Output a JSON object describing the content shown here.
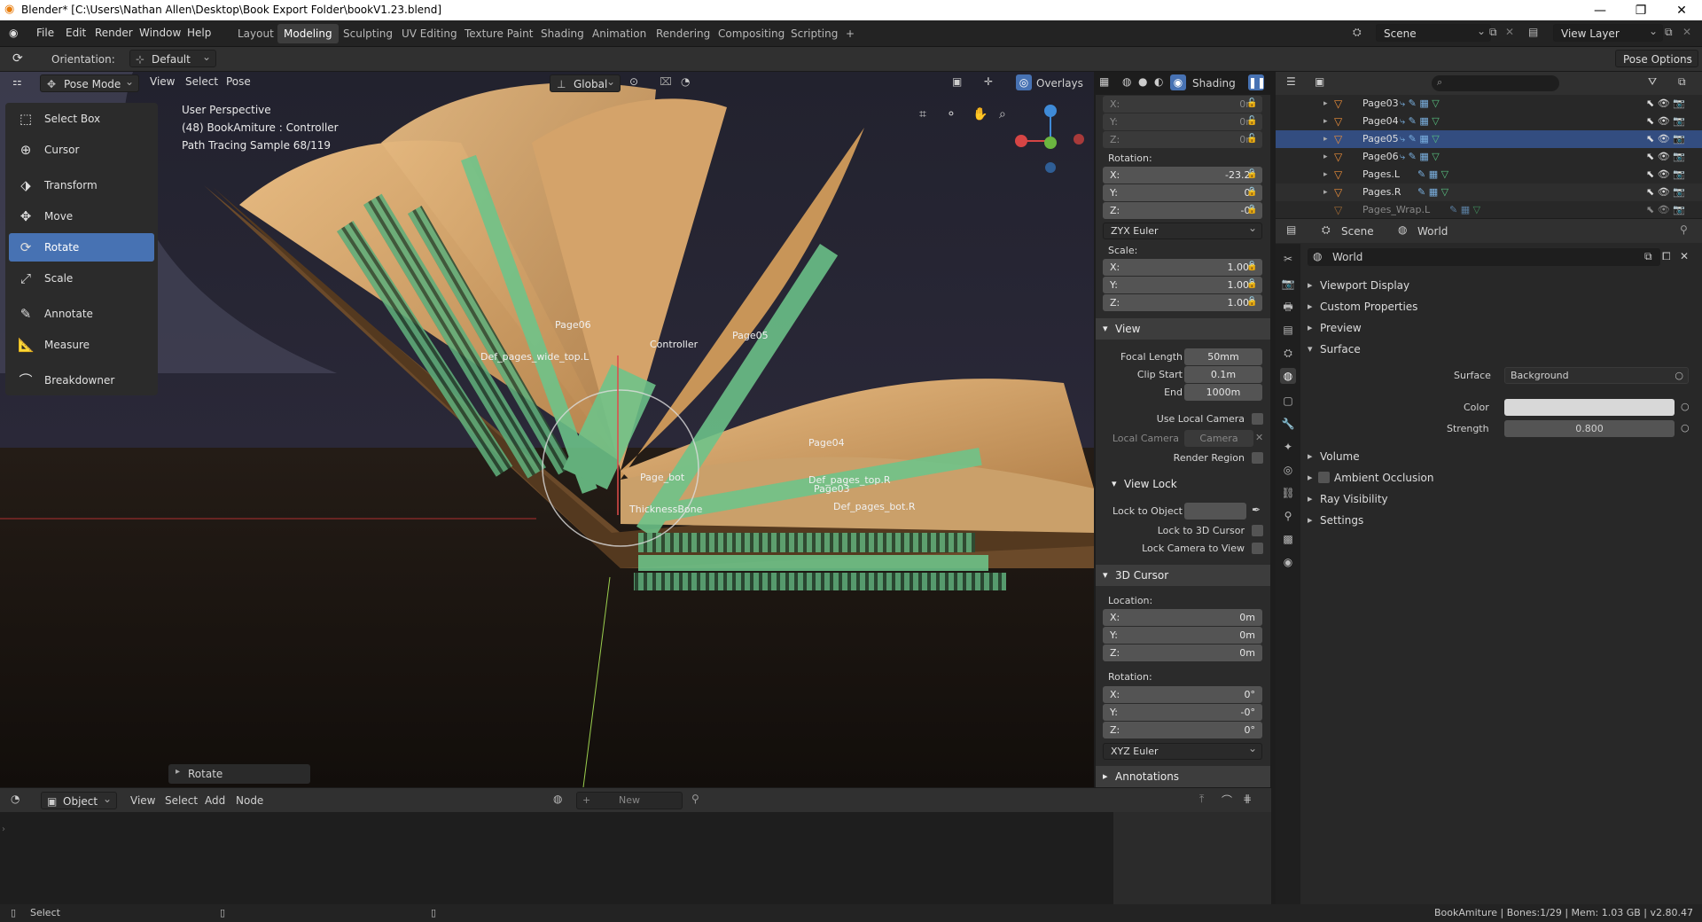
{
  "window": {
    "title": "Blender* [C:\\Users\\Nathan Allen\\Desktop\\Book Export Folder\\bookV1.23.blend]"
  },
  "menu": {
    "items": [
      "File",
      "Edit",
      "Render",
      "Window",
      "Help"
    ]
  },
  "workspaces": {
    "tabs": [
      "Layout",
      "Modeling",
      "Sculpting",
      "UV Editing",
      "Texture Paint",
      "Shading",
      "Animation",
      "Rendering",
      "Compositing",
      "Scripting"
    ],
    "active": "Modeling",
    "add": "+"
  },
  "scene": {
    "name": "Scene",
    "view_layer": "View Layer"
  },
  "tool_header": {
    "orientation_label": "Orientation:",
    "orientation_value": "Default",
    "pose_options": "Pose Options"
  },
  "viewport_header": {
    "mode": "Pose Mode",
    "menus": [
      "View",
      "Select",
      "Pose"
    ],
    "transform_orientation": "Global",
    "overlays": "Overlays",
    "shading": "Shading"
  },
  "toolbar": {
    "tools": [
      "Select Box",
      "Cursor",
      "Transform",
      "Move",
      "Rotate",
      "Scale",
      "Annotate",
      "Measure",
      "Breakdowner"
    ],
    "active": "Rotate"
  },
  "viewport_info": {
    "perspective": "User Perspective",
    "object": "(48) BookAmiture : Controller",
    "render": "Path Tracing Sample 68/119"
  },
  "bone_labels": [
    "Page06",
    "Def_pages_wide_top.L",
    "Controller",
    "Page05",
    "Page04",
    "Page_bot",
    "Def_pages_top.R",
    "Page03",
    "ThicknessBone",
    "Def_pages_bot.R"
  ],
  "last_op": "Rotate",
  "npanel": {
    "location_values": [
      "0m",
      "0m",
      "0m"
    ],
    "rotation_label": "Rotation:",
    "rotation_values": [
      "-23.2°",
      "0°",
      "-0°"
    ],
    "rotation_mode": "ZYX Euler",
    "scale_label": "Scale:",
    "scale_values": [
      "1.000",
      "1.000",
      "1.000"
    ],
    "axis": [
      "X:",
      "Y:",
      "Z:"
    ],
    "view": {
      "title": "View",
      "focal_label": "Focal Length",
      "focal": "50mm",
      "clip_start_label": "Clip Start",
      "clip_start": "0.1m",
      "end_label": "End",
      "end": "1000m",
      "use_local_camera": "Use Local Camera",
      "local_camera_label": "Local Camera",
      "local_camera": "Camera",
      "render_region": "Render Region"
    },
    "view_lock": {
      "title": "View Lock",
      "lock_object": "Lock to Object",
      "lock_cursor": "Lock to 3D Cursor",
      "lock_camera": "Lock Camera to View"
    },
    "cursor": {
      "title": "3D Cursor",
      "location_label": "Location:",
      "location": [
        "0m",
        "0m",
        "0m"
      ],
      "rotation_label": "Rotation:",
      "rotation": [
        "0°",
        "-0°",
        "0°"
      ],
      "rotation_mode": "XYZ Euler"
    },
    "annotations": "Annotations"
  },
  "outliner": {
    "rows": [
      "Page03",
      "Page04",
      "Page05",
      "Page06",
      "Pages.L",
      "Pages.R",
      "Pages_Wrap.L"
    ],
    "selected": "Page05"
  },
  "properties": {
    "context": [
      "Scene",
      "World"
    ],
    "world_name": "World",
    "sections": [
      "Viewport Display",
      "Custom Properties",
      "Preview",
      "Surface"
    ],
    "surface_label": "Surface",
    "surface_value": "Background",
    "color_label": "Color",
    "color_value": "#d8d8d8",
    "strength_label": "Strength",
    "strength_value": "0.800",
    "more_sections": [
      "Volume",
      "Ambient Occlusion",
      "Ray Visibility",
      "Settings"
    ]
  },
  "node_editor": {
    "type": "Object",
    "menus": [
      "View",
      "Select",
      "Add",
      "Node"
    ],
    "new_button": "New"
  },
  "status": {
    "select": "Select",
    "info": "BookAmiture | Bones:1/29 | Mem: 1.03 GB | v2.80.47"
  },
  "colors": {
    "accent": "#4772b3",
    "bone": "#6dc48a",
    "selected_row": "#334d80",
    "page": "#d9a86b"
  }
}
